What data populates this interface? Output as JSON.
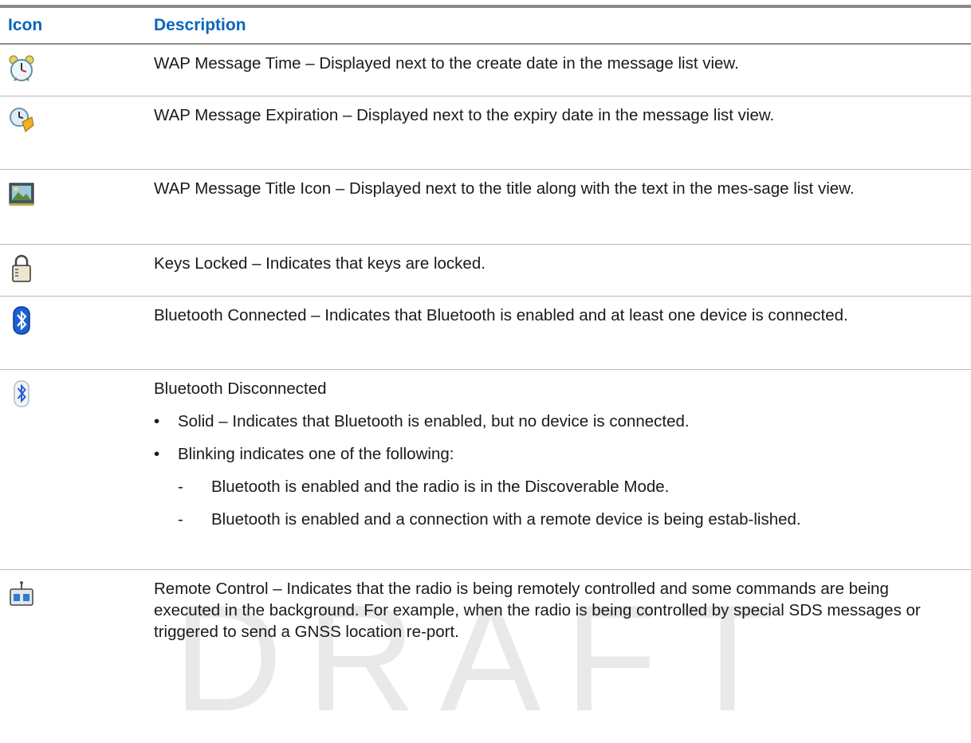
{
  "watermark": "DRAFT",
  "table": {
    "headers": {
      "icon": "Icon",
      "description": "Description"
    },
    "rows": [
      {
        "icon": "alarm-clock-icon",
        "text": "WAP Message Time – Displayed next to the create date in the message list view."
      },
      {
        "icon": "clock-expiration-icon",
        "text": "WAP Message Expiration – Displayed next to the expiry date in the message list view."
      },
      {
        "icon": "picture-title-icon",
        "text": "WAP Message Title Icon – Displayed next to the title along with the text in the mes-sage list view."
      },
      {
        "icon": "padlock-icon",
        "text": "Keys Locked – Indicates that keys are locked."
      },
      {
        "icon": "bluetooth-connected-icon",
        "text": "Bluetooth Connected – Indicates that Bluetooth is enabled and at least one device is connected."
      },
      {
        "icon": "bluetooth-disconnected-icon",
        "text": "Bluetooth Disconnected",
        "bullets": [
          "Solid – Indicates that Bluetooth is enabled, but no device is connected.",
          "Blinking indicates one of the following:"
        ],
        "subbullets": [
          "Bluetooth is enabled and the radio is in the Discoverable Mode.",
          "Bluetooth is enabled and a connection with a remote device is being estab-lished."
        ]
      },
      {
        "icon": "remote-control-icon",
        "text": "Remote Control – Indicates that the radio is being remotely controlled and some commands are being executed in the background. For example, when the radio is being controlled by special SDS messages or triggered to send a GNSS location re-port."
      }
    ]
  }
}
